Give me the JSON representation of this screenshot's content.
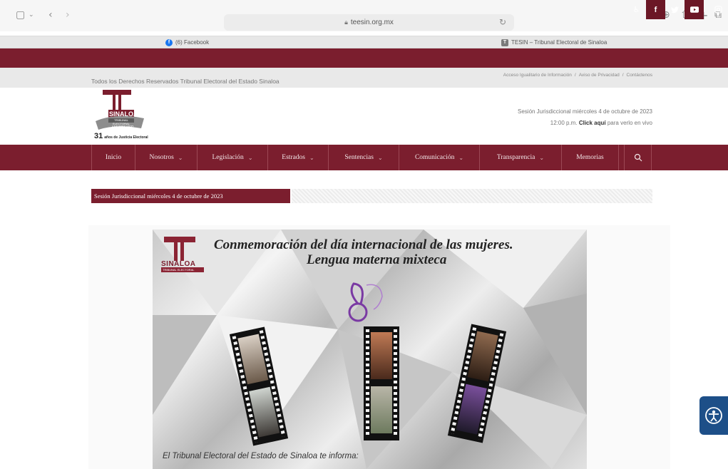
{
  "browser": {
    "url": "teesin.org.mx",
    "tabs": [
      {
        "label": "(6) Facebook",
        "icon": "facebook-icon"
      },
      {
        "label": "TESIN – Tribunal Electoral de Sinaloa",
        "icon": "site-favicon-icon"
      }
    ]
  },
  "social": [
    "accessibility-icon",
    "facebook-icon",
    "twitter-icon",
    "youtube-icon",
    "instagram-icon"
  ],
  "header": {
    "rights": "Todos los Derechos Reservados Tribunal Electoral del Estado Sinaloa",
    "links": [
      "Acceso Igualitario de Información",
      "/",
      "Aviso de Privacidad",
      "/",
      "Contáctenos"
    ],
    "logo": {
      "letter": "T",
      "name": "SINALOA",
      "ribbon": "TRIBUNAL ELECTORAL",
      "anniv": "ANIVERSARIO",
      "years": "31",
      "tagline": "años de Justicia Electoral"
    },
    "session_line1": "Sesión Jurisdiccional miércoles 4 de octubre de 2023",
    "session_line2_pre": "12:00 p.m.",
    "session_link": "Click aquí",
    "session_line2_post": "para verlo en vivo"
  },
  "nav": [
    {
      "label": "Inicio",
      "dropdown": false
    },
    {
      "label": "Nosotros",
      "dropdown": true
    },
    {
      "label": "Legislación",
      "dropdown": true
    },
    {
      "label": "Estrados",
      "dropdown": true
    },
    {
      "label": "Sentencias",
      "dropdown": true
    },
    {
      "label": "Comunicación",
      "dropdown": true
    },
    {
      "label": "Transparencia",
      "dropdown": true
    },
    {
      "label": "Memorias",
      "dropdown": false
    }
  ],
  "ticker": "Sesión Jurisdiccional miércoles 4 de octubre de 2023",
  "banner": {
    "title": "Conmemoración del día internacional de las mujeres.",
    "subtitle": "Lengua materna mixteca",
    "logo_name": "SINALOA",
    "logo_ribbon": "TRIBUNAL ELECTORAL",
    "footer": "El Tribunal Electoral del Estado de Sinaloa te informa:"
  },
  "colors": {
    "brand": "#7b1e2e",
    "accessibility": "#1d4f88"
  }
}
